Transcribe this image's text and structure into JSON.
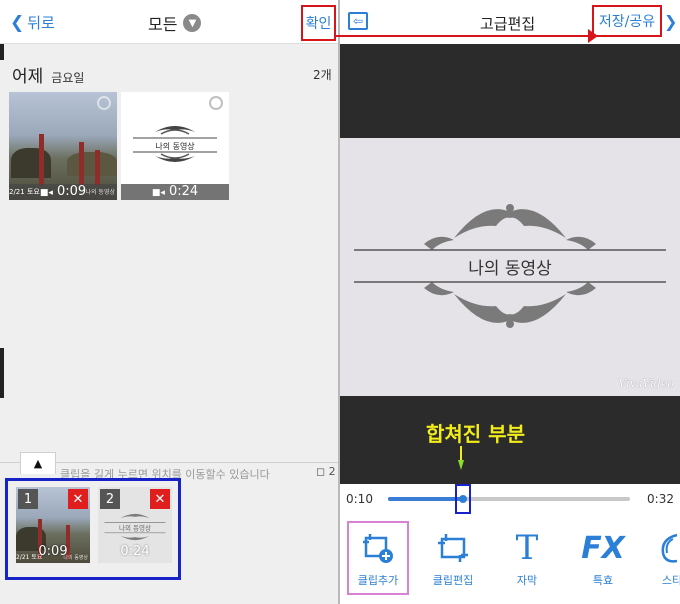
{
  "left": {
    "header": {
      "back_label": "뒤로",
      "title": "모든",
      "confirm_label": "확인"
    },
    "section": {
      "title": "어제",
      "subtitle": "금요일",
      "count": "2개"
    },
    "gallery": [
      {
        "duration": "0:09",
        "overlay_left": "2/21 토요",
        "overlay_right": "나의 동영상"
      },
      {
        "duration": "0:24",
        "title_text": "나의 동영상"
      }
    ],
    "tray": {
      "hint": "클립을 길게 누르면 위치를 이동할수 있습니다",
      "hint_count": "2",
      "clips": [
        {
          "index": "1",
          "duration": "0:09",
          "overlay_left": "2/21 토요",
          "overlay_right": "나의 동영상"
        },
        {
          "index": "2",
          "duration": "0:24",
          "title_text": "나의 동영상"
        }
      ]
    }
  },
  "right": {
    "header": {
      "title": "고급편집",
      "save_label": "저장/공유"
    },
    "preview": {
      "title_text": "나의 동영상",
      "watermark": "VivaVideo"
    },
    "annotation": "합쳐진 부분",
    "timeline": {
      "current": "0:10",
      "total": "0:32",
      "progress": 0.31
    },
    "toolbar": [
      {
        "label": "클립추가",
        "icon": "clip-add-icon"
      },
      {
        "label": "클립편집",
        "icon": "clip-edit-icon"
      },
      {
        "label": "자막",
        "icon": "text-icon"
      },
      {
        "label": "특효",
        "icon": "fx-icon"
      },
      {
        "label": "스티",
        "icon": "sticker-icon"
      }
    ]
  },
  "colors": {
    "accent": "#2b7fd6",
    "highlight_red": "#d8141b",
    "highlight_blue": "#1722c9",
    "annotation_yellow": "#f2ec1a"
  }
}
